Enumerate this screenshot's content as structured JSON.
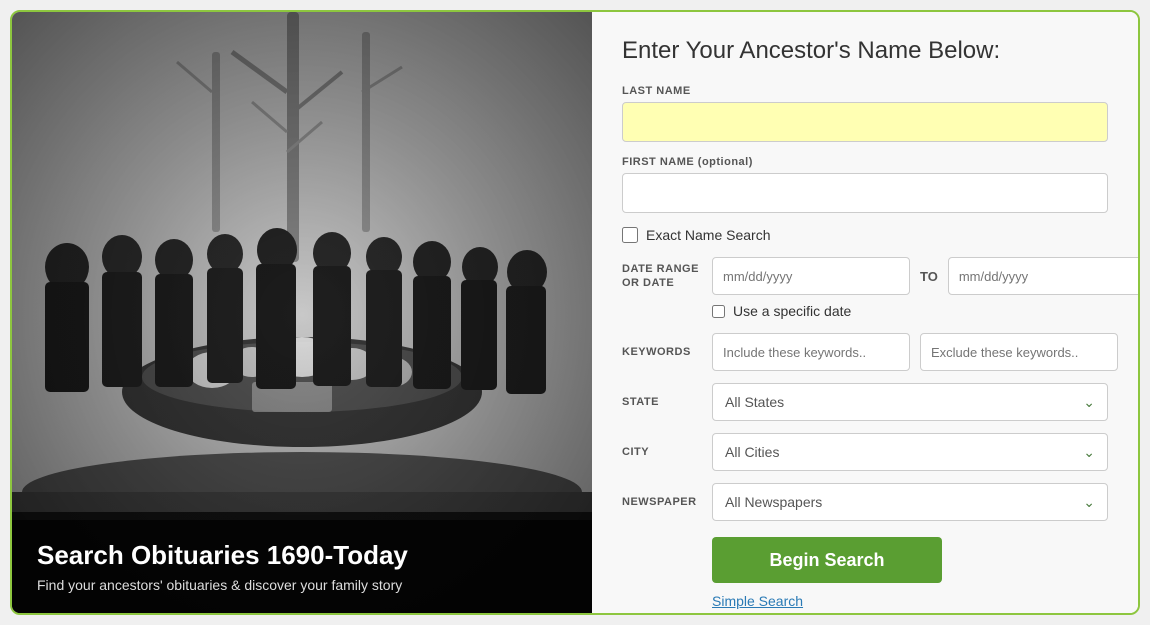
{
  "page": {
    "border_color": "#8dc63f"
  },
  "left_panel": {
    "overlay_title": "Search Obituaries 1690-Today",
    "overlay_subtitle": "Find your ancestors' obituaries & discover your family story"
  },
  "right_panel": {
    "heading": "Enter Your Ancestor's Name Below:",
    "last_name_label": "LAST NAME",
    "last_name_placeholder": "",
    "first_name_label": "FIRST NAME (optional)",
    "first_name_placeholder": "",
    "exact_name_label": "Exact Name Search",
    "date_range_label": "DATE RANGE OR DATE",
    "date_from_placeholder": "mm/dd/yyyy",
    "date_to_label": "TO",
    "date_to_placeholder": "mm/dd/yyyy",
    "specific_date_label": "Use a specific date",
    "keywords_label": "KEYWORDS",
    "include_keywords_placeholder": "Include these keywords..",
    "exclude_keywords_placeholder": "Exclude these keywords..",
    "state_label": "STATE",
    "state_value": "All States",
    "city_label": "CITY",
    "city_value": "All Cities",
    "newspaper_label": "NEWSPAPER",
    "newspaper_value": "All Newspapers",
    "begin_search_label": "Begin Search",
    "simple_search_label": "Simple Search",
    "chevron_symbol": "⌄"
  }
}
